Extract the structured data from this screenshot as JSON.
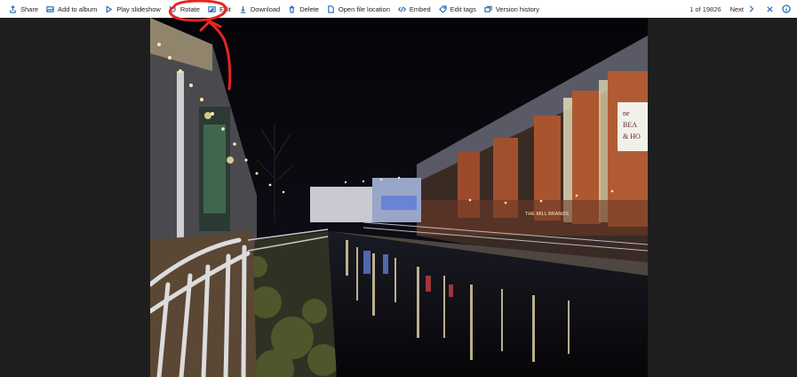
{
  "toolbar": {
    "items": [
      {
        "label": "Share",
        "icon": "share-icon"
      },
      {
        "label": "Add to album",
        "icon": "album-icon"
      },
      {
        "label": "Play slideshow",
        "icon": "play-icon"
      },
      {
        "label": "Rotate",
        "icon": "rotate-icon"
      },
      {
        "label": "Edit",
        "icon": "edit-icon"
      },
      {
        "label": "Download",
        "icon": "download-icon"
      },
      {
        "label": "Delete",
        "icon": "delete-icon"
      },
      {
        "label": "Open file location",
        "icon": "file-icon"
      },
      {
        "label": "Embed",
        "icon": "embed-icon"
      },
      {
        "label": "Edit tags",
        "icon": "tag-icon"
      },
      {
        "label": "Version history",
        "icon": "history-icon"
      }
    ],
    "counter": "1 of 19826",
    "next_label": "Next"
  },
  "photo": {
    "sign_lines": [
      "ne",
      "BEA",
      "& HO"
    ],
    "shop_sign": "THE MILL BRANDS"
  },
  "colors": {
    "accent": "#2b6cb5",
    "annotation": "#e8251f",
    "stage_bg": "#1e1e1e"
  }
}
